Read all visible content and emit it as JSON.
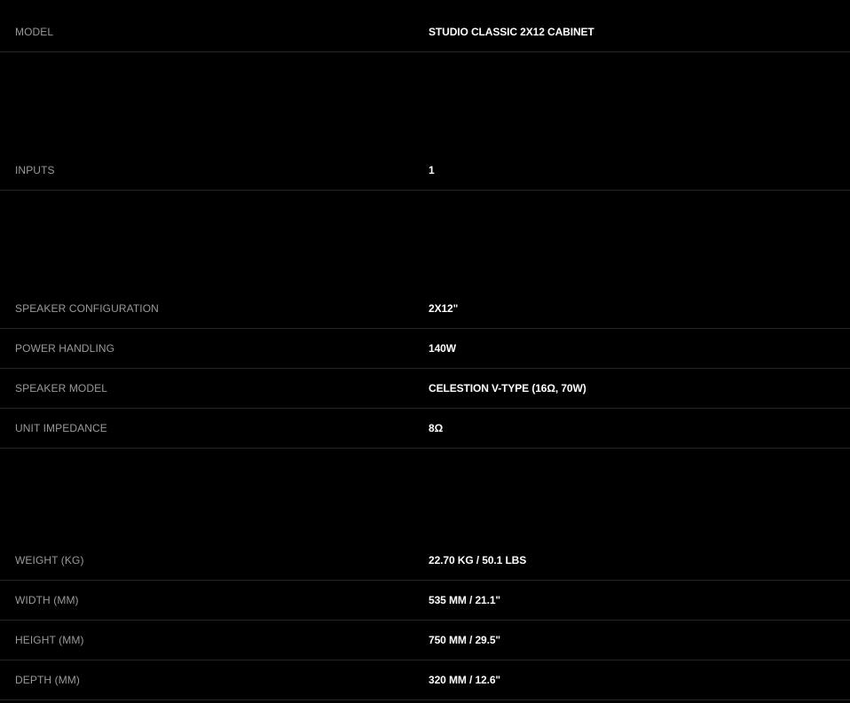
{
  "specs": {
    "model": {
      "label": "MODEL",
      "value": "STUDIO CLASSIC 2X12 CABINET"
    },
    "inputs": {
      "label": "INPUTS",
      "value": "1"
    },
    "speaker_configuration": {
      "label": "SPEAKER CONFIGURATION",
      "value": "2X12\""
    },
    "power_handling": {
      "label": "POWER HANDLING",
      "value": "140W"
    },
    "speaker_model": {
      "label": "SPEAKER MODEL",
      "value": "CELESTION V-TYPE (16Ω, 70W)"
    },
    "unit_impedance": {
      "label": "UNIT IMPEDANCE",
      "value": "8Ω"
    },
    "weight": {
      "label": "WEIGHT (KG)",
      "value": "22.70 KG / 50.1 LBS"
    },
    "width": {
      "label": "WIDTH (MM)",
      "value": "535 MM / 21.1\""
    },
    "height": {
      "label": "HEIGHT (MM)",
      "value": "750 MM / 29.5\""
    },
    "depth": {
      "label": "DEPTH (MM)",
      "value": "320 MM / 12.6\""
    }
  },
  "colors": {
    "background": "#000000",
    "label": "#9a9a9a",
    "value": "#ffffff",
    "divider": "#262626"
  }
}
